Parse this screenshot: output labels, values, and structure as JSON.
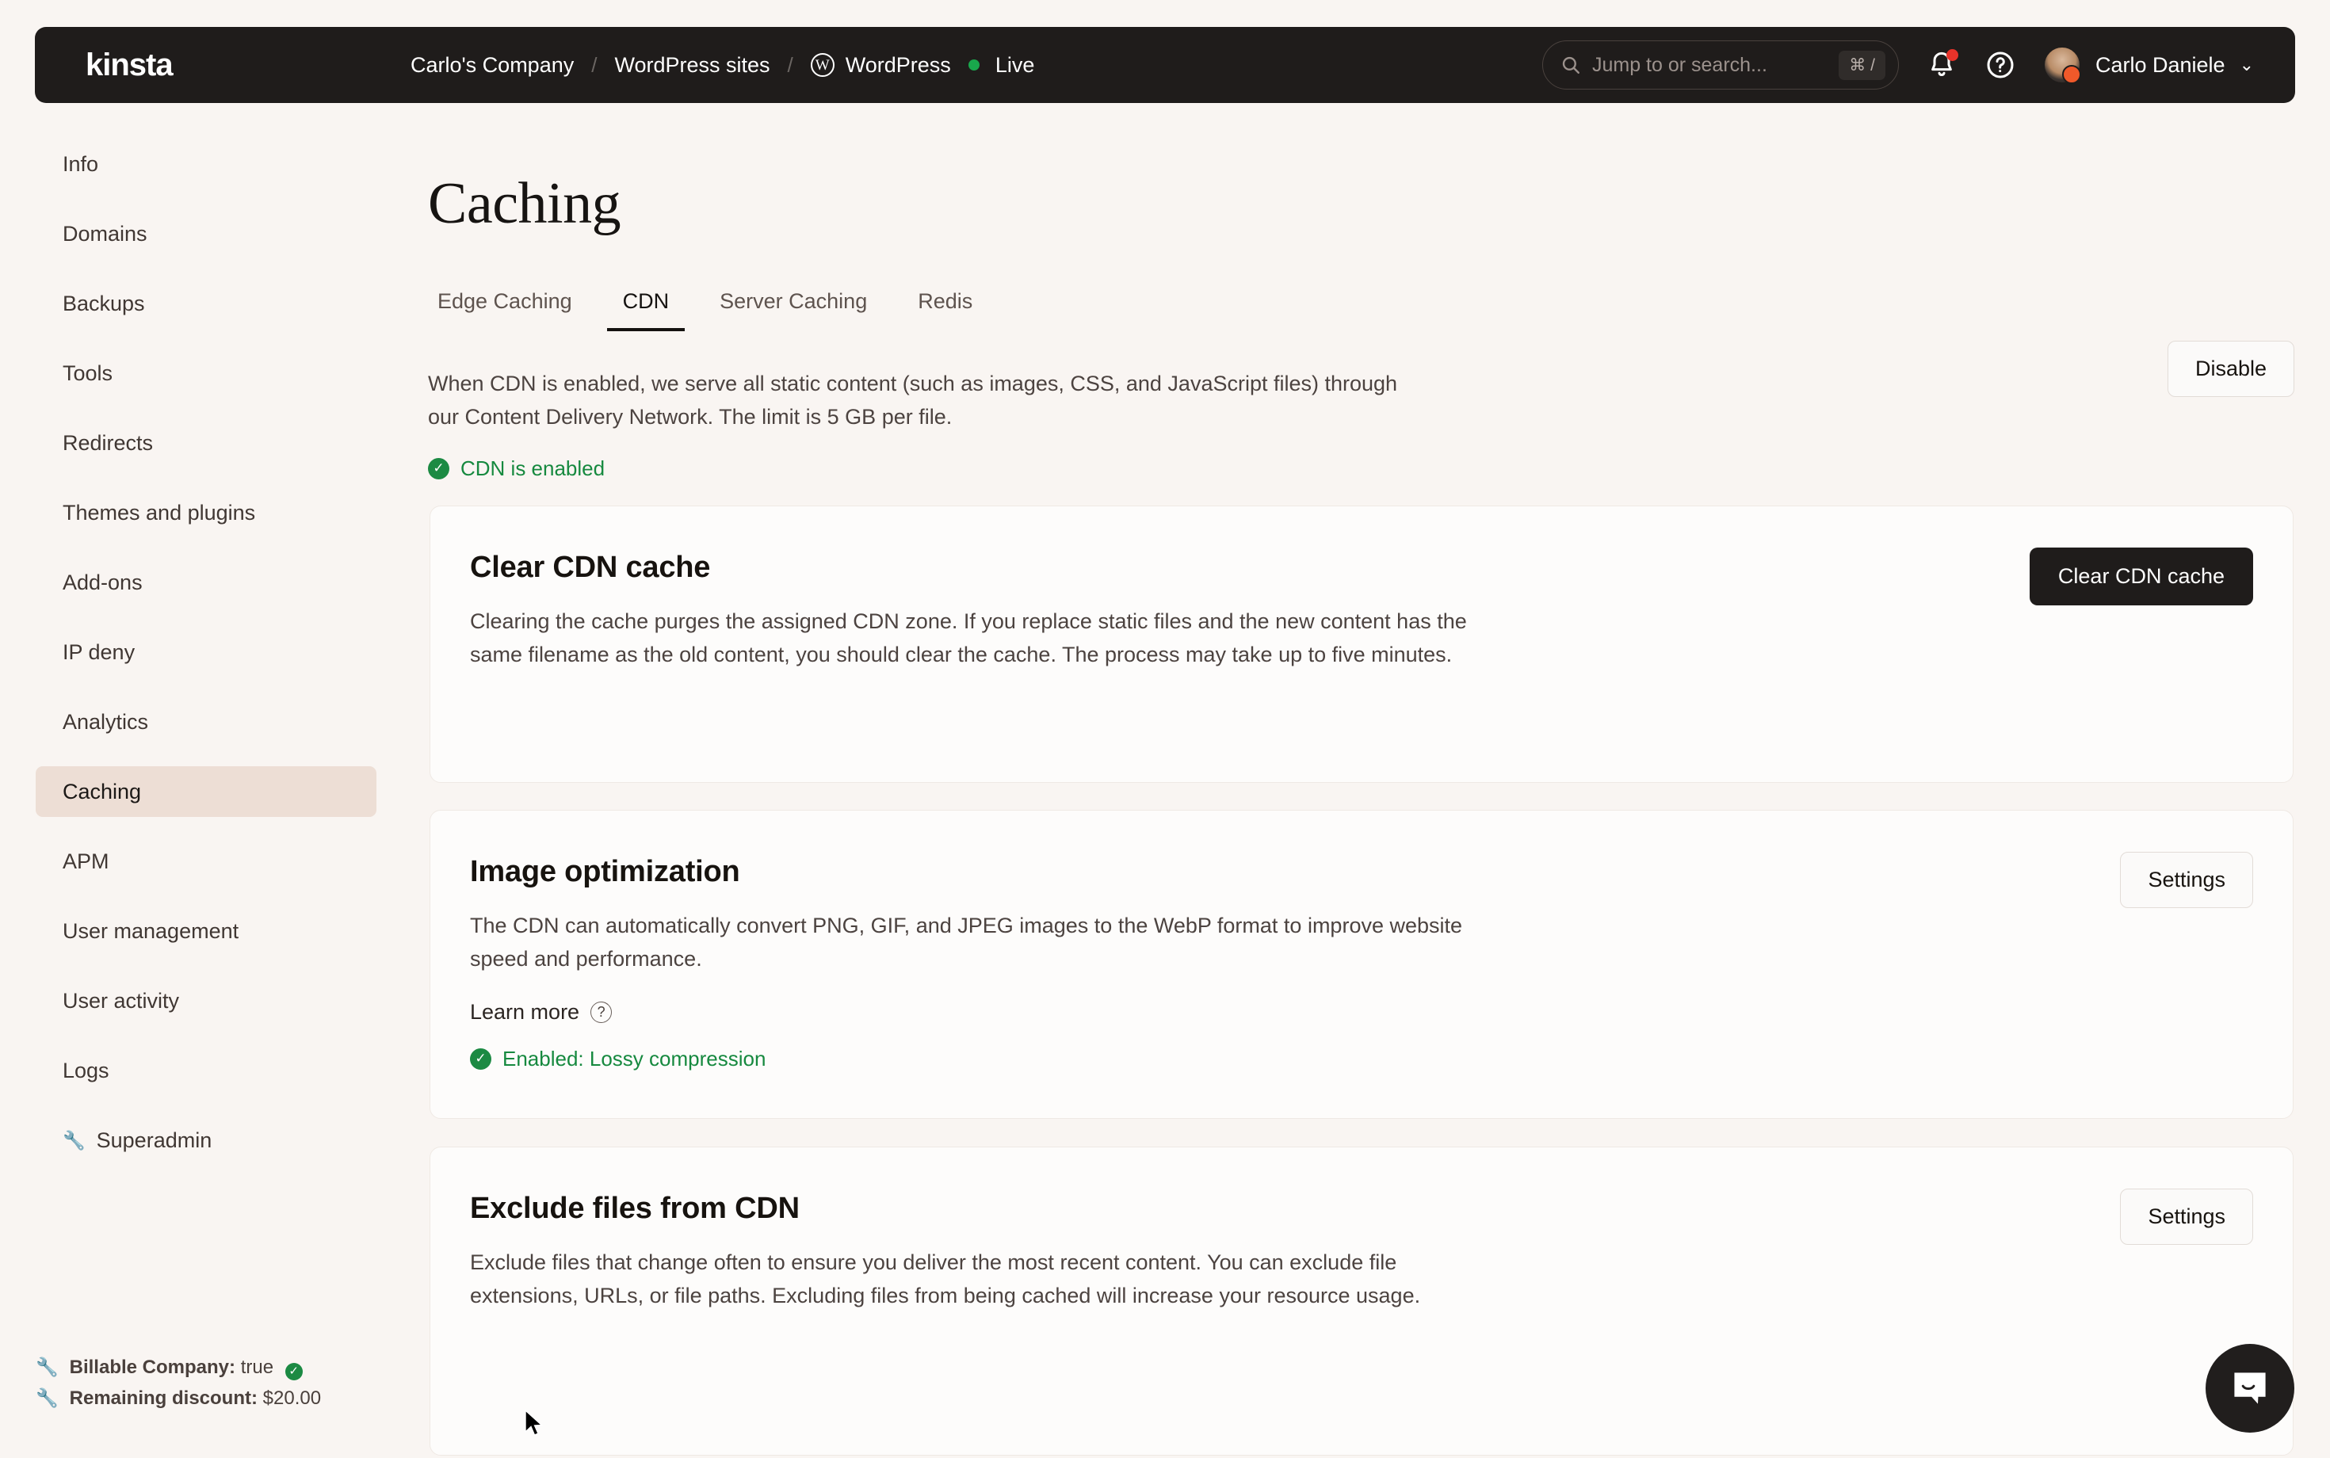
{
  "brand": {
    "logo_text": "kinsta",
    "accent": "#EDDED5",
    "dark": "#1F1C1B",
    "green": "#1C8A43"
  },
  "topbar": {
    "breadcrumb": [
      {
        "label": "Carlo's Company"
      },
      {
        "label": "WordPress sites"
      },
      {
        "label": "WordPress"
      }
    ],
    "separator": "/",
    "site_status": "Live",
    "search": {
      "placeholder": "Jump to or search...",
      "shortcut": "⌘ /"
    },
    "notifications_icon": "bell-icon",
    "help_icon": "help-circle-icon",
    "user_name": "Carlo Daniele",
    "user_chevron": "⌄"
  },
  "sidebar": {
    "items": [
      {
        "label": "Info",
        "active": false
      },
      {
        "label": "Domains",
        "active": false
      },
      {
        "label": "Backups",
        "active": false
      },
      {
        "label": "Tools",
        "active": false
      },
      {
        "label": "Redirects",
        "active": false
      },
      {
        "label": "Themes and plugins",
        "active": false
      },
      {
        "label": "Add-ons",
        "active": false
      },
      {
        "label": "IP deny",
        "active": false
      },
      {
        "label": "Analytics",
        "active": false
      },
      {
        "label": "Caching",
        "active": true
      },
      {
        "label": "APM",
        "active": false
      },
      {
        "label": "User management",
        "active": false
      },
      {
        "label": "User activity",
        "active": false
      },
      {
        "label": "Logs",
        "active": false
      },
      {
        "label": "Superadmin",
        "active": false,
        "icon": "wrench-icon"
      }
    ],
    "footer": {
      "billable_label": "Billable Company:",
      "billable_value": "true",
      "discount_label": "Remaining discount:",
      "discount_value": "$20.00"
    }
  },
  "main": {
    "page_title": "Caching",
    "tabs": [
      {
        "label": "Edge Caching",
        "active": false
      },
      {
        "label": "CDN",
        "active": true
      },
      {
        "label": "Server Caching",
        "active": false
      },
      {
        "label": "Redis",
        "active": false
      }
    ],
    "intro": {
      "description": "When CDN is enabled, we serve all static content (such as images, CSS, and JavaScript files) through our Content Delivery Network. The limit is 5 GB per file.",
      "status_text": "CDN is enabled",
      "disable_button": "Disable"
    },
    "cards": [
      {
        "title": "Clear CDN cache",
        "description": "Clearing the cache purges the assigned CDN zone. If you replace static files and the new content has the same filename as the old content, you should clear the cache. The process may take up to five minutes.",
        "action_label": "Clear CDN cache",
        "action_style": "dark"
      },
      {
        "title": "Image optimization",
        "description": "The CDN can automatically convert PNG, GIF, and JPEG images to the WebP format to improve website speed and performance.",
        "learn_more": "Learn more",
        "status_text": "Enabled: Lossy compression",
        "action_label": "Settings",
        "action_style": "light"
      },
      {
        "title": "Exclude files from CDN",
        "description": "Exclude files that change often to ensure you deliver the most recent content. You can exclude file extensions, URLs, or file paths. Excluding files from being cached will increase your resource usage.",
        "action_label": "Settings",
        "action_style": "light"
      }
    ]
  },
  "chat": {
    "icon": "chat-bubble-icon"
  }
}
